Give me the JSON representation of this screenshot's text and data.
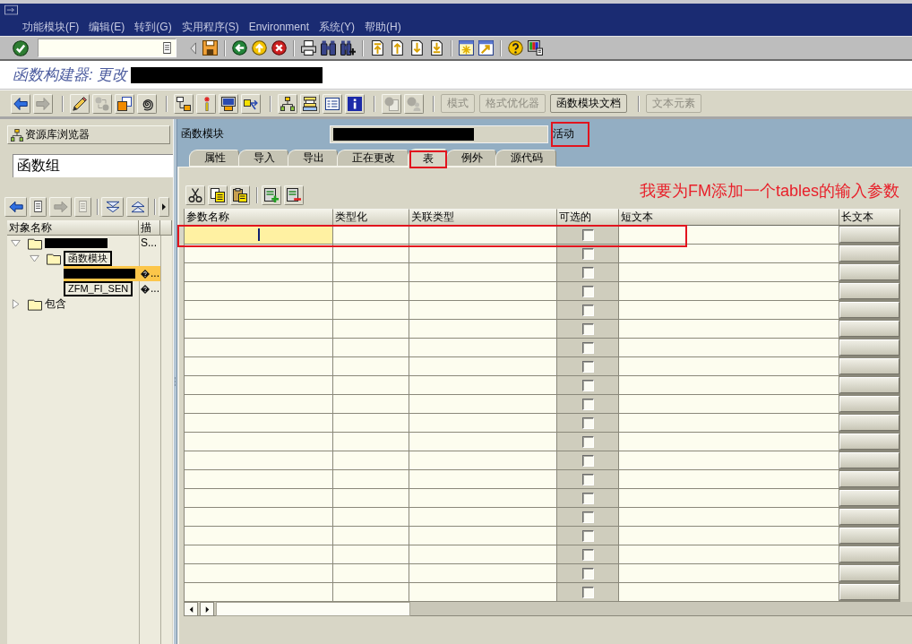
{
  "menu_bar": {
    "items": [
      "功能模块(F)",
      "编辑(E)",
      "转到(G)",
      "实用程序(S)",
      "Environment",
      "系统(Y)",
      "帮助(H)"
    ]
  },
  "title": "函数构建器: 更改",
  "application_toolbar": {
    "icon_groups": [
      [
        {
          "kind": "back",
          "disabled": false
        },
        {
          "kind": "forward",
          "disabled": true
        }
      ],
      [
        {
          "kind": "display-change",
          "disabled": false
        },
        {
          "kind": "active-inactive",
          "disabled": true
        },
        {
          "kind": "check-object",
          "disabled": false
        },
        {
          "kind": "where-used",
          "disabled": false
        }
      ],
      [
        {
          "kind": "object-tree",
          "disabled": false
        },
        {
          "kind": "activate",
          "disabled": false
        },
        {
          "kind": "test",
          "disabled": false
        },
        {
          "kind": "navigate",
          "disabled": false
        }
      ],
      [
        {
          "kind": "hierarchy",
          "disabled": false
        },
        {
          "kind": "stack",
          "disabled": false
        },
        {
          "kind": "list",
          "disabled": false
        },
        {
          "kind": "info",
          "disabled": false
        }
      ],
      [
        {
          "kind": "pattern",
          "disabled": true
        },
        {
          "kind": "pretty-print",
          "disabled": true
        }
      ]
    ],
    "button_groups": [
      [
        {
          "label": "模式",
          "disabled": true
        },
        {
          "label": "格式优化器",
          "disabled": true
        },
        {
          "label": "函数模块文档",
          "disabled": false
        }
      ],
      [
        {
          "label": "文本元素",
          "disabled": true
        }
      ]
    ]
  },
  "repository_browser": {
    "title": "资源库浏览器",
    "object_type": "函数组",
    "toolbar": [
      [
        {
          "kind": "back",
          "disabled": false
        },
        {
          "kind": "document",
          "disabled": false
        },
        {
          "kind": "forward",
          "disabled": true
        },
        {
          "kind": "document",
          "disabled": true
        }
      ],
      [
        {
          "kind": "expand-all",
          "disabled": false
        },
        {
          "kind": "collapse-all",
          "disabled": false
        }
      ],
      [
        {
          "kind": "scroll-right",
          "disabled": false
        }
      ]
    ],
    "columns": [
      "对象名称",
      "描"
    ],
    "tree": [
      {
        "redacted": true,
        "description": "S...",
        "garbled": false,
        "expanded": true,
        "selected": false,
        "children": [
          {
            "name": "函数模块",
            "redacted": false,
            "outlined": true,
            "expanded": true,
            "selected": false,
            "children": [
              {
                "redacted": true,
                "description": "...",
                "garbled": true,
                "selected": true
              },
              {
                "name": "ZFM_FI_SEN",
                "redacted": false,
                "outlined": true,
                "description": "...",
                "garbled": true,
                "selected": false
              }
            ]
          }
        ]
      },
      {
        "name": "包含",
        "redacted": false,
        "outlined": false,
        "expanded": false,
        "selected": false
      }
    ]
  },
  "function_module": {
    "label": "函数模块",
    "status": "活动",
    "status_marked": true
  },
  "tabs": [
    {
      "label": "属性",
      "selected": false,
      "marked": false
    },
    {
      "label": "导入",
      "selected": false,
      "marked": false
    },
    {
      "label": "导出",
      "selected": false,
      "marked": false
    },
    {
      "label": "正在更改",
      "selected": false,
      "marked": false
    },
    {
      "label": "表",
      "selected": true,
      "marked": true
    },
    {
      "label": "例外",
      "selected": false,
      "marked": false
    },
    {
      "label": "源代码",
      "selected": false,
      "marked": false
    }
  ],
  "tab_panel": {
    "annotation": "我要为FM添加一个tables的输入参数",
    "table": {
      "columns": [
        {
          "label": "参数名称",
          "kind": "input"
        },
        {
          "label": "类型化",
          "kind": "input"
        },
        {
          "label": "关联类型",
          "kind": "input"
        },
        {
          "label": "可选的",
          "kind": "checkbox"
        },
        {
          "label": "短文本",
          "kind": "input"
        },
        {
          "label": "长文本",
          "kind": "button"
        }
      ],
      "rows": [
        {
          "focused": true,
          "optional": false,
          "marked": true
        },
        {
          "focused": false,
          "optional": false,
          "marked": false
        },
        {
          "focused": false,
          "optional": false,
          "marked": false
        },
        {
          "focused": false,
          "optional": false,
          "marked": false
        },
        {
          "focused": false,
          "optional": false,
          "marked": false
        },
        {
          "focused": false,
          "optional": false,
          "marked": false
        },
        {
          "focused": false,
          "optional": false,
          "marked": false
        },
        {
          "focused": false,
          "optional": false,
          "marked": false
        },
        {
          "focused": false,
          "optional": false,
          "marked": false
        },
        {
          "focused": false,
          "optional": false,
          "marked": false
        },
        {
          "focused": false,
          "optional": false,
          "marked": false
        },
        {
          "focused": false,
          "optional": false,
          "marked": false
        },
        {
          "focused": false,
          "optional": false,
          "marked": false
        },
        {
          "focused": false,
          "optional": false,
          "marked": false
        },
        {
          "focused": false,
          "optional": false,
          "marked": false
        },
        {
          "focused": false,
          "optional": false,
          "marked": false
        },
        {
          "focused": false,
          "optional": false,
          "marked": false
        },
        {
          "focused": false,
          "optional": false,
          "marked": false
        },
        {
          "focused": false,
          "optional": false,
          "marked": false
        },
        {
          "focused": false,
          "optional": false,
          "marked": false
        }
      ]
    }
  }
}
